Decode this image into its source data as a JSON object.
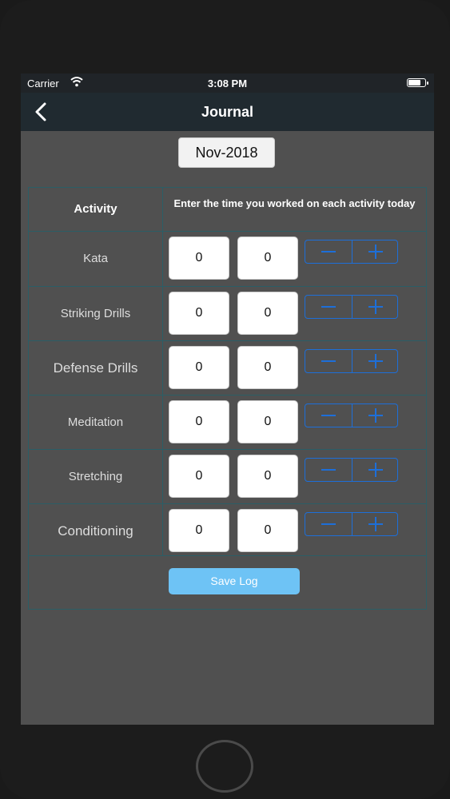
{
  "status_bar": {
    "carrier": "Carrier",
    "time": "3:08 PM",
    "battery_level": 0.7
  },
  "nav": {
    "title": "Journal"
  },
  "date": "Nov-2018",
  "table": {
    "header_activity": "Activity",
    "header_instruction": "Enter the time you worked on each activity today",
    "rows": [
      {
        "label": "Kata",
        "value1": "0",
        "value2": "0"
      },
      {
        "label": "Striking Drills",
        "value1": "0",
        "value2": "0"
      },
      {
        "label": "Defense Drills",
        "value1": "0",
        "value2": "0"
      },
      {
        "label": "Meditation",
        "value1": "0",
        "value2": "0"
      },
      {
        "label": "Stretching",
        "value1": "0",
        "value2": "0"
      },
      {
        "label": "Conditioning",
        "value1": "0",
        "value2": "0"
      }
    ]
  },
  "save_label": "Save Log",
  "colors": {
    "accent": "#1d6fd9",
    "save_button": "#6ec3f5",
    "grid": "#2b5e66"
  }
}
